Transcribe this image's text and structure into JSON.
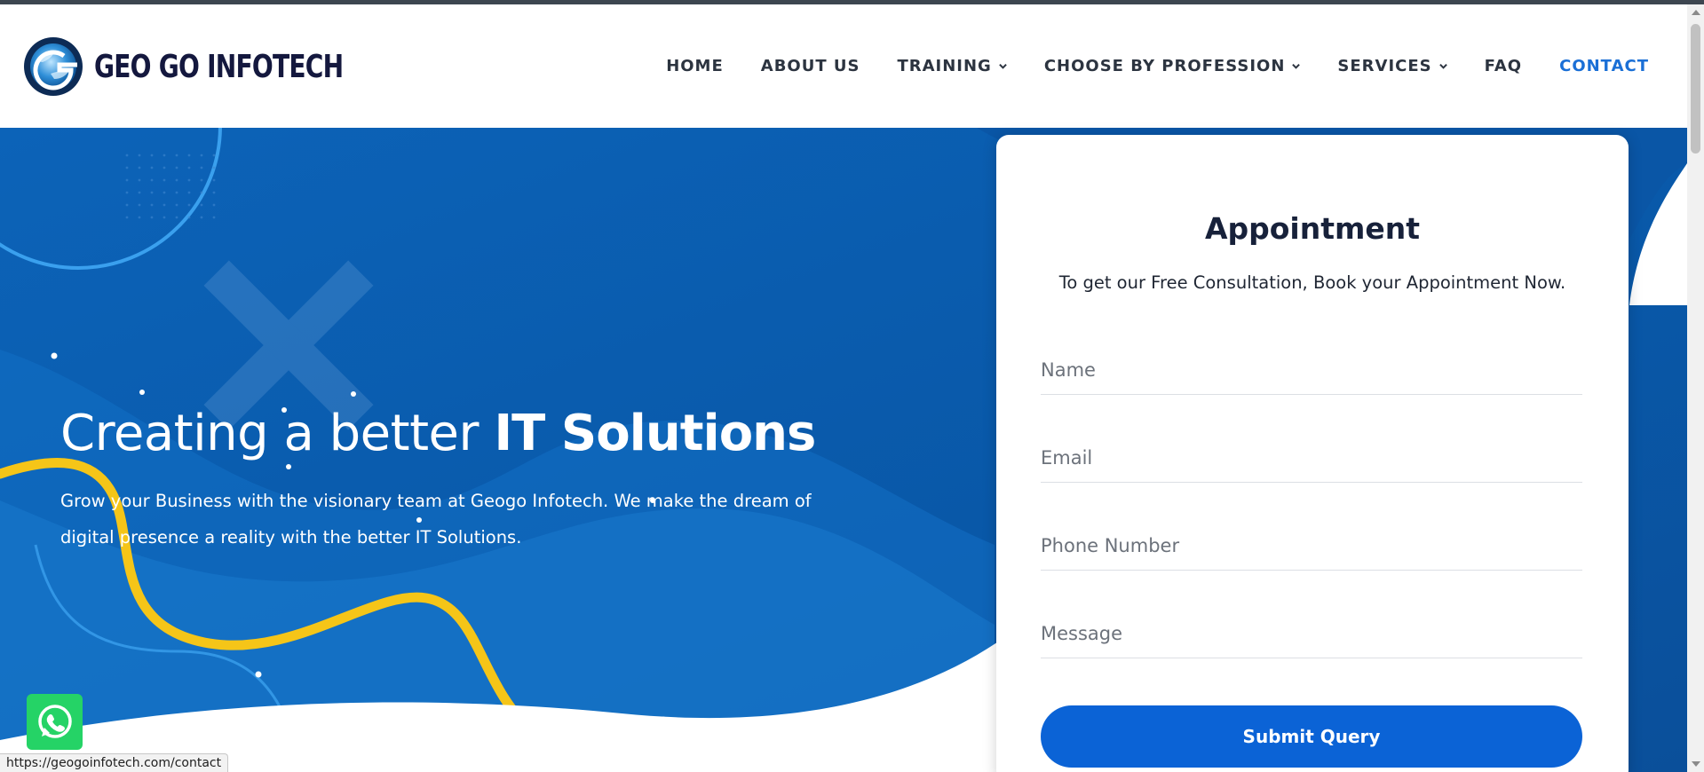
{
  "brand": {
    "name": "GEO GO INFOTECH"
  },
  "nav": {
    "items": [
      {
        "label": "HOME",
        "dropdown": false
      },
      {
        "label": "ABOUT US",
        "dropdown": false
      },
      {
        "label": "TRAINING",
        "dropdown": true
      },
      {
        "label": "CHOOSE BY PROFESSION",
        "dropdown": true
      },
      {
        "label": "SERVICES",
        "dropdown": true
      },
      {
        "label": "FAQ",
        "dropdown": false
      },
      {
        "label": "CONTACT",
        "dropdown": false,
        "active": true
      }
    ]
  },
  "hero": {
    "title_light": "Creating a better ",
    "title_bold": "IT Solutions",
    "subtitle": "Grow your Business with the visionary team at Geogo Infotech. We make the dream of digital presence a reality with the better IT Solutions."
  },
  "appointment": {
    "title": "Appointment",
    "subtitle": "To get our Free Consultation, Book your Appointment Now.",
    "fields": {
      "name_placeholder": "Name",
      "email_placeholder": "Email",
      "phone_placeholder": "Phone Number",
      "message_placeholder": "Message"
    },
    "submit_label": "Submit Query"
  },
  "status_bar": {
    "url": "https://geogoinfotech.com/contact"
  },
  "icons": {
    "whatsapp": "whatsapp-icon",
    "dropdown": "chevron-down-icon"
  },
  "colors": {
    "accent": "#0b63d6",
    "hero_blue": "#0a5cac",
    "yellow_ribbon": "#f5c518",
    "logo_dark": "#14183e",
    "whatsapp": "#25d366"
  }
}
